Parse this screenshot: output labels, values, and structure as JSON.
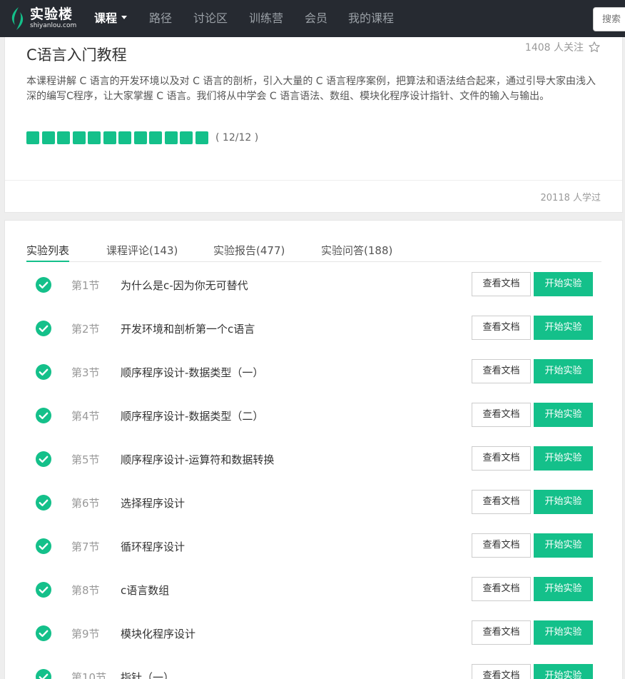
{
  "brand": {
    "name_cn": "实验楼",
    "name_en": "shiyanlou.com",
    "accent": "#14c08a"
  },
  "nav": {
    "items": [
      {
        "label": "课程",
        "active": true
      },
      {
        "label": "路径"
      },
      {
        "label": "讨论区"
      },
      {
        "label": "训练营"
      },
      {
        "label": "会员"
      },
      {
        "label": "我的课程"
      }
    ],
    "search_placeholder": "搜索"
  },
  "course": {
    "title": "C语言入门教程",
    "followers": "1408 人关注",
    "description": "本课程讲解 C 语言的开发环境以及对 C 语言的剖析，引入大量的 C 语言程序案例，把算法和语法结合起来，通过引导大家由浅入深的编写C程序，让大家掌握 C 语言。我们将从中学会 C 语言语法、数组、模块化程序设计指针、文件的输入与输出。",
    "progress": {
      "done": 12,
      "total": 12,
      "text": "( 12/12 )"
    },
    "learned": "20118 人学过"
  },
  "tabs": [
    {
      "label": "实验列表",
      "active": true
    },
    {
      "label": "课程评论(143)"
    },
    {
      "label": "实验报告(477)"
    },
    {
      "label": "实验问答(188)"
    }
  ],
  "buttons": {
    "doc": "查看文档",
    "start": "开始实验"
  },
  "sections": [
    {
      "num": "第1节",
      "title": "为什么是c-因为你无可替代"
    },
    {
      "num": "第2节",
      "title": "开发环境和剖析第一个c语言"
    },
    {
      "num": "第3节",
      "title": "顺序程序设计-数据类型（一）"
    },
    {
      "num": "第4节",
      "title": "顺序程序设计-数据类型（二）"
    },
    {
      "num": "第5节",
      "title": "顺序程序设计-运算符和数据转换"
    },
    {
      "num": "第6节",
      "title": "选择程序设计"
    },
    {
      "num": "第7节",
      "title": "循环程序设计"
    },
    {
      "num": "第8节",
      "title": "c语言数组"
    },
    {
      "num": "第9节",
      "title": "模块化程序设计"
    },
    {
      "num": "第10节",
      "title": "指针（一）"
    }
  ]
}
